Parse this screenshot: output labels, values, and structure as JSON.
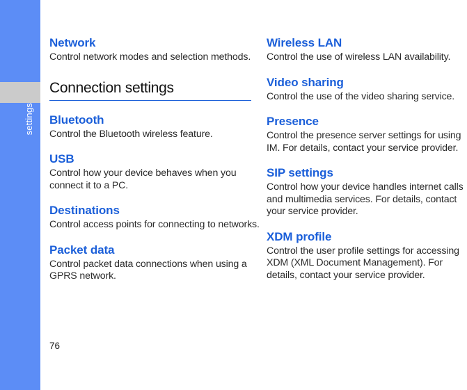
{
  "page": {
    "number": "76",
    "tab_label": "settings",
    "accent_blue": "#1b5fd9",
    "rail_blue": "#5c8df6",
    "rail_gap_gray": "#cbcbcb"
  },
  "left_column": {
    "entries_top": [
      {
        "title": "Network",
        "body": "Control network modes and selection methods."
      }
    ],
    "section": {
      "title": "Connection settings"
    },
    "entries_bottom": [
      {
        "title": "Bluetooth",
        "body": "Control the Bluetooth wireless feature."
      },
      {
        "title": "USB",
        "body": "Control how your device behaves when you connect it to a PC."
      },
      {
        "title": "Destinations",
        "body": "Control access points for connecting to networks."
      },
      {
        "title": "Packet data",
        "body": "Control packet data connections when using a GPRS network."
      }
    ]
  },
  "right_column": {
    "entries": [
      {
        "title": "Wireless LAN",
        "body": "Control the use of wireless LAN availability."
      },
      {
        "title": "Video sharing",
        "body": "Control the use of the video sharing service."
      },
      {
        "title": "Presence",
        "body": "Control the presence server settings for using IM. For details, contact your service provider."
      },
      {
        "title": "SIP settings",
        "body": "Control how your device handles internet calls and multimedia services. For details, contact your service provider."
      },
      {
        "title": "XDM profile",
        "body": "Control the user profile settings for accessing XDM (XML Document Management). For details, contact your service provider."
      }
    ]
  }
}
